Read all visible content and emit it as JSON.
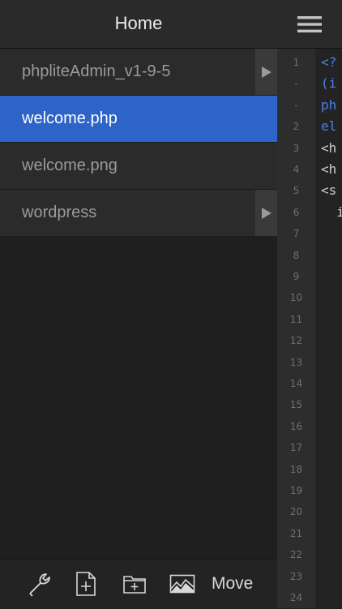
{
  "header": {
    "title": "Home"
  },
  "files": [
    {
      "label": "phpliteAdmin_v1-9-5",
      "folder": true,
      "selected": false
    },
    {
      "label": "welcome.php",
      "folder": false,
      "selected": true
    },
    {
      "label": "welcome.png",
      "folder": false,
      "selected": false
    },
    {
      "label": "wordpress",
      "folder": true,
      "selected": false
    }
  ],
  "toolbar": {
    "icons": [
      "wrench-icon",
      "new-file-icon",
      "new-folder-icon",
      "image-icon"
    ],
    "move_label": "Move"
  },
  "editor": {
    "gutter": [
      "1",
      "-",
      "-",
      "2",
      "3",
      "4",
      "5",
      "6",
      "7",
      "8",
      "9",
      "10",
      "11",
      "12",
      "13",
      "14",
      "15",
      "16",
      "17",
      "18",
      "19",
      "20",
      "21",
      "22",
      "23",
      "24"
    ],
    "code_lines": [
      {
        "text": "<?",
        "color": "#4f7fe8"
      },
      {
        "text": "(i",
        "color": "#4f7fe8"
      },
      {
        "text": "ph",
        "color": "#4f7fe8"
      },
      {
        "text": "el",
        "color": "#4f7fe8"
      },
      {
        "text": "<h",
        "color": "#cfcfcf"
      },
      {
        "text": "<h",
        "color": "#cfcfcf"
      },
      {
        "text": "<s",
        "color": "#cfcfcf"
      },
      {
        "text": "  i",
        "color": "#cfcfcf"
      }
    ]
  },
  "colors": {
    "accent": "#2e63c7",
    "background": "#1f1f1f"
  }
}
